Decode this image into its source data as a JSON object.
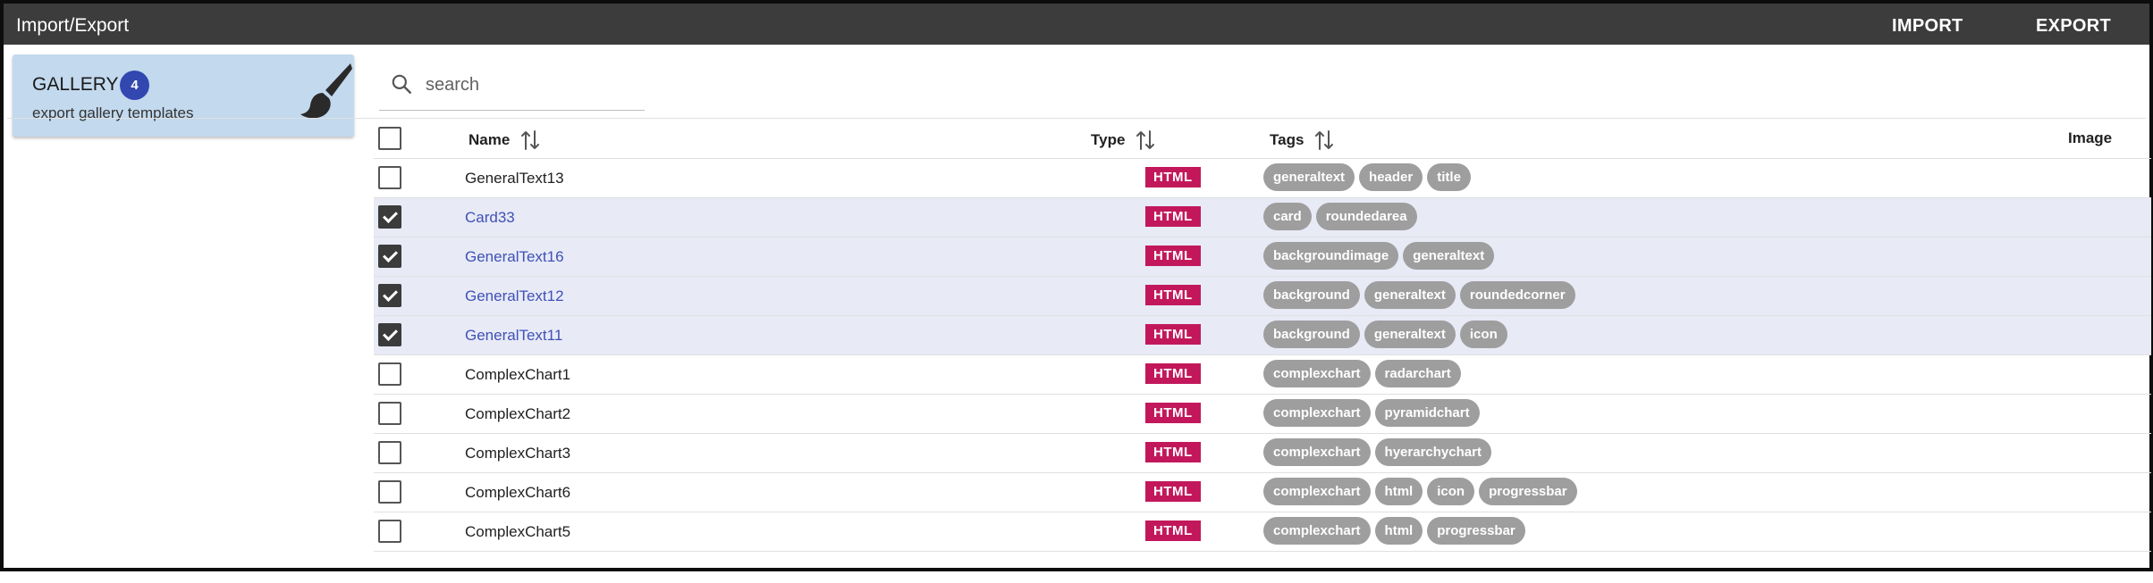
{
  "header": {
    "title": "Import/Export",
    "import_label": "IMPORT",
    "export_label": "EXPORT"
  },
  "gallery": {
    "title": "GALLERY",
    "count": "4",
    "subtitle": "export gallery templates",
    "icon": "paintbrush-icon"
  },
  "search": {
    "placeholder": "search",
    "value": ""
  },
  "table": {
    "columns": {
      "name": "Name",
      "type": "Type",
      "tags": "Tags",
      "image": "Image"
    },
    "rows": [
      {
        "name": "GeneralText13",
        "type": "HTML",
        "selected": false,
        "tags": [
          "generaltext",
          "header",
          "title"
        ]
      },
      {
        "name": "Card33",
        "type": "HTML",
        "selected": true,
        "tags": [
          "card",
          "roundedarea"
        ]
      },
      {
        "name": "GeneralText16",
        "type": "HTML",
        "selected": true,
        "tags": [
          "backgroundimage",
          "generaltext"
        ]
      },
      {
        "name": "GeneralText12",
        "type": "HTML",
        "selected": true,
        "tags": [
          "background",
          "generaltext",
          "roundedcorner"
        ]
      },
      {
        "name": "GeneralText11",
        "type": "HTML",
        "selected": true,
        "tags": [
          "background",
          "generaltext",
          "icon"
        ]
      },
      {
        "name": "ComplexChart1",
        "type": "HTML",
        "selected": false,
        "tags": [
          "complexchart",
          "radarchart"
        ]
      },
      {
        "name": "ComplexChart2",
        "type": "HTML",
        "selected": false,
        "tags": [
          "complexchart",
          "pyramidchart"
        ]
      },
      {
        "name": "ComplexChart3",
        "type": "HTML",
        "selected": false,
        "tags": [
          "complexchart",
          "hyerarchychart"
        ]
      },
      {
        "name": "ComplexChart6",
        "type": "HTML",
        "selected": false,
        "tags": [
          "complexchart",
          "html",
          "icon",
          "progressbar"
        ]
      },
      {
        "name": "ComplexChart5",
        "type": "HTML",
        "selected": false,
        "tags": [
          "complexchart",
          "html",
          "progressbar"
        ]
      }
    ]
  },
  "colors": {
    "topbar": "#3c3c3c",
    "card": "#c2d9ee",
    "badge": "#3347b0",
    "type_badge": "#c2185b",
    "tag": "#9e9e9e",
    "selected_row": "#e8eaf6",
    "selected_link": "#3f51b5"
  }
}
